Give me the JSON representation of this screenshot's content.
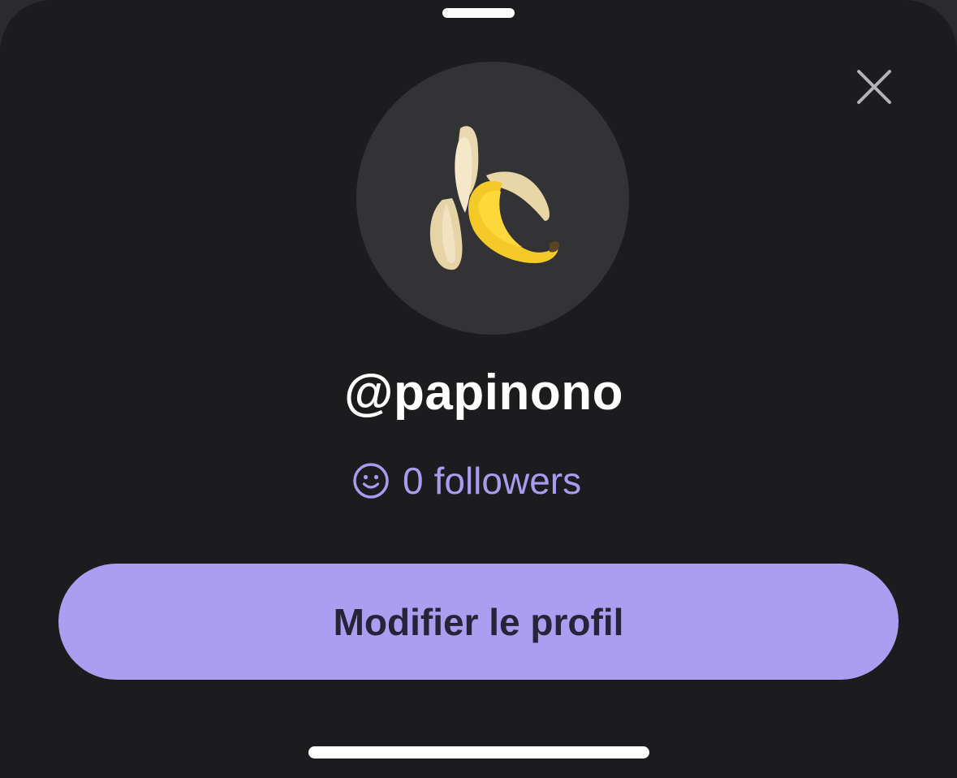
{
  "profile": {
    "username": "@papinono",
    "followers_count": "0",
    "followers_label": "followers",
    "avatar_emoji": "banana-emoji"
  },
  "actions": {
    "edit_profile_label": "Modifier le profil"
  },
  "icons": {
    "close": "close-icon",
    "followers": "smiley-icon"
  },
  "colors": {
    "background": "#1c1c1e",
    "avatar_circle": "#333335",
    "accent": "#a99bf0",
    "button_fill": "#ab9ef0",
    "button_text": "#27243a",
    "text_primary": "#ffffff"
  }
}
